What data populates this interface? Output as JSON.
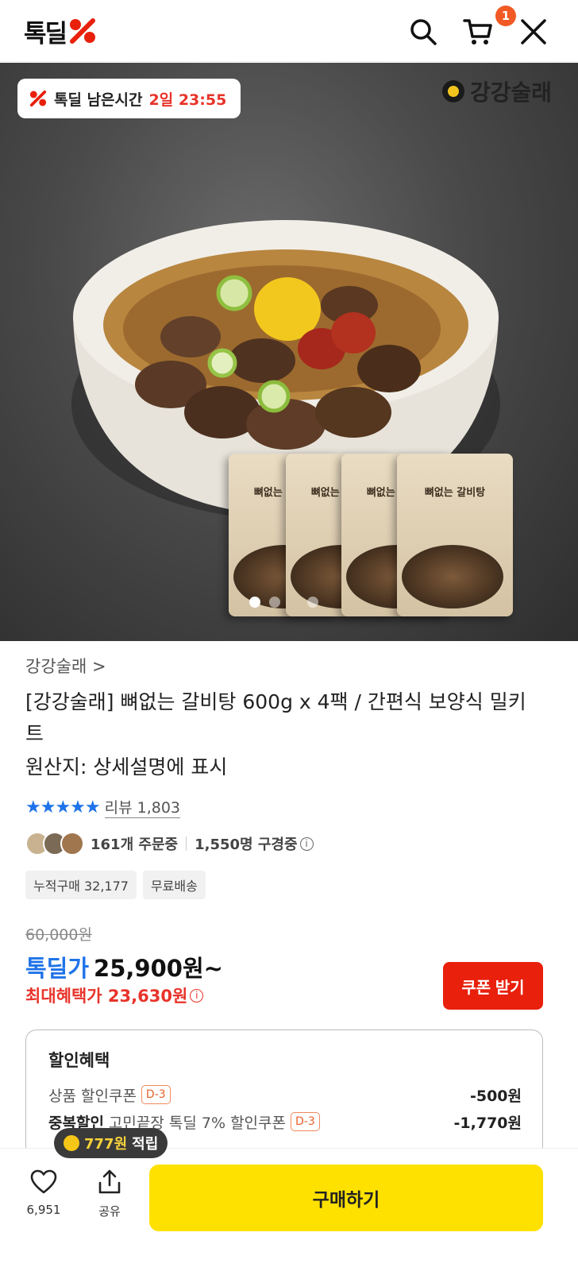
{
  "header": {
    "logo_text": "톡딜",
    "icons": [
      "search-icon",
      "cart-icon",
      "close-icon"
    ],
    "cart_count": "1"
  },
  "hero": {
    "timer_label": "톡딜 남은시간",
    "timer_value": "2일 23:55",
    "brand_mark": "강강술래",
    "pack_label": "뼈없는 갈비탕",
    "slide_count": 3,
    "active_slide": 1
  },
  "product": {
    "seller": "강강술래 >",
    "title": "[강강술래] 뼈없는 갈비탕 600g x 4팩 / 간편식 보양식 밀키트",
    "origin": "원산지: 상세설명에 표시",
    "stars": "★★★★★",
    "review_label": "리뷰 1,803",
    "ordering": "161개 주문중",
    "browsing": "1,550명 구경중",
    "tags": [
      "누적구매 32,177",
      "무료배송"
    ]
  },
  "price": {
    "original": "60,000원",
    "deal_label": "톡딜가",
    "deal_price": "25,900원~",
    "max_benefit": "최대혜택가 23,630원",
    "coupon_button": "쿠폰 받기"
  },
  "benefits": {
    "title": "할인혜택",
    "rows": [
      {
        "strong": "",
        "name": "상품 할인쿠폰",
        "dday": "D-3",
        "amount": "-500원"
      },
      {
        "strong": "중복할인",
        "name": "고민끝장 톡딜 7% 할인쿠폰",
        "dday": "D-3",
        "amount": "-1,770원"
      }
    ]
  },
  "bottom": {
    "point_amount": "777원",
    "point_label": "적립",
    "like_count": "6,951",
    "share_label": "공유",
    "buy_button": "구매하기"
  },
  "colors": {
    "accent_red": "#e8332a",
    "accent_blue": "#1f73e8",
    "buy_yellow": "#ffe100"
  }
}
